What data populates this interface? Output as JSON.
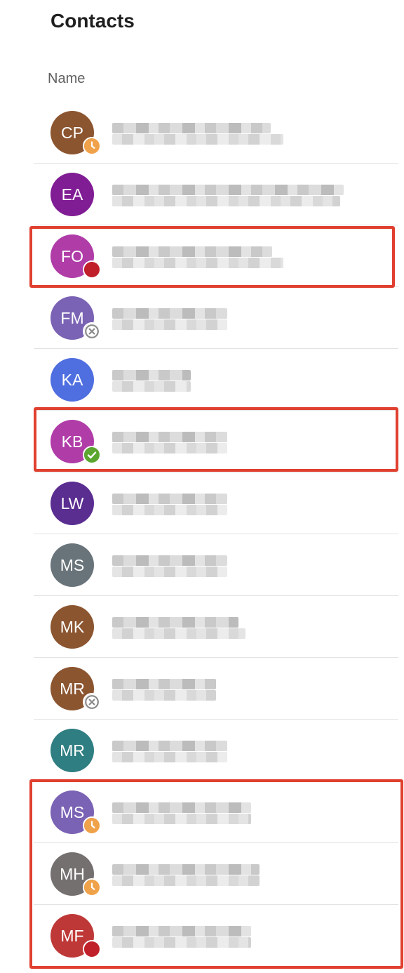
{
  "page": {
    "title": "Contacts",
    "column_header": "Name"
  },
  "colors": {
    "highlight": "#e0402f",
    "status_away": "#f0a24a",
    "status_busy": "#c0202a",
    "status_offline": "#8a8a8a",
    "status_available": "#5aa62f"
  },
  "contacts": [
    {
      "initials": "CP",
      "avatar_color": "#8b5530",
      "status": "away",
      "status_icon": "clock-icon"
    },
    {
      "initials": "EA",
      "avatar_color": "#801c94",
      "status": "none",
      "status_icon": ""
    },
    {
      "initials": "FO",
      "avatar_color": "#b03ca8",
      "status": "busy",
      "status_icon": "busy-dot-icon"
    },
    {
      "initials": "FM",
      "avatar_color": "#7a62b4",
      "status": "offline",
      "status_icon": "x-circle-icon"
    },
    {
      "initials": "KA",
      "avatar_color": "#4f6ee0",
      "status": "none",
      "status_icon": ""
    },
    {
      "initials": "KB",
      "avatar_color": "#b03ca8",
      "status": "available",
      "status_icon": "check-circle-icon"
    },
    {
      "initials": "LW",
      "avatar_color": "#5a2d91",
      "status": "none",
      "status_icon": ""
    },
    {
      "initials": "MS",
      "avatar_color": "#69737a",
      "status": "none",
      "status_icon": ""
    },
    {
      "initials": "MK",
      "avatar_color": "#8b5530",
      "status": "none",
      "status_icon": ""
    },
    {
      "initials": "MR",
      "avatar_color": "#8b5530",
      "status": "offline",
      "status_icon": "x-circle-icon"
    },
    {
      "initials": "MR",
      "avatar_color": "#2f7e82",
      "status": "none",
      "status_icon": ""
    },
    {
      "initials": "MS",
      "avatar_color": "#7a62b4",
      "status": "away",
      "status_icon": "clock-icon"
    },
    {
      "initials": "MH",
      "avatar_color": "#757070",
      "status": "away",
      "status_icon": "clock-icon"
    },
    {
      "initials": "MF",
      "avatar_color": "#bf3838",
      "status": "busy",
      "status_icon": "busy-dot-icon"
    }
  ]
}
